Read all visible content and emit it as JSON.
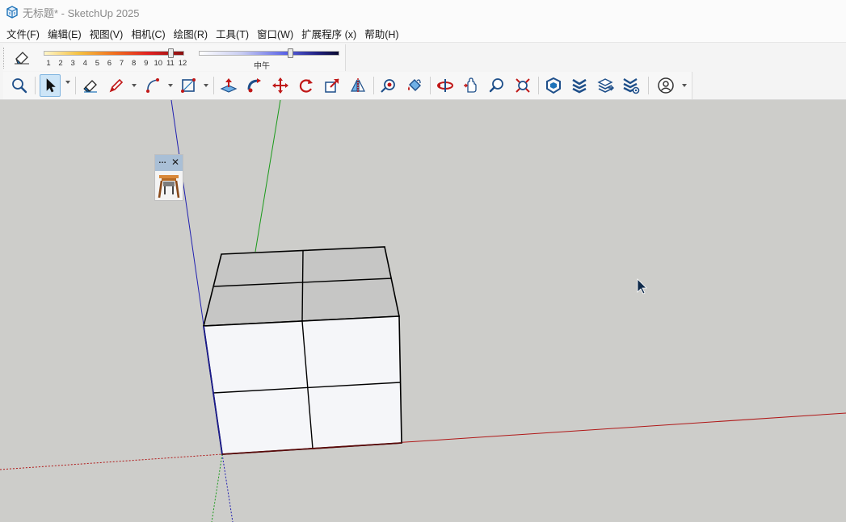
{
  "window": {
    "title": "无标题* - SketchUp 2025"
  },
  "menu": {
    "items": [
      {
        "label": "文件(F)"
      },
      {
        "label": "编辑(E)"
      },
      {
        "label": "视图(V)"
      },
      {
        "label": "相机(C)"
      },
      {
        "label": "绘图(R)"
      },
      {
        "label": "工具(T)"
      },
      {
        "label": "窗口(W)"
      },
      {
        "label": "扩展程序 (x)"
      },
      {
        "label": "帮助(H)"
      }
    ]
  },
  "shadow_toolbar": {
    "hour_ticks": [
      "1",
      "2",
      "3",
      "4",
      "5",
      "6",
      "7",
      "8",
      "9",
      "10",
      "11",
      "12"
    ],
    "hour_value": 0.9,
    "time_label": "中午",
    "time_value": 0.65,
    "hour_gradient_colors": [
      "#fff6c8",
      "#f5c040",
      "#f07020",
      "#e02020",
      "#8a1010"
    ],
    "time_gradient_colors": [
      "#ffffff",
      "#5a63e6",
      "#0a0a30"
    ]
  },
  "tools": [
    {
      "name": "zoom-extents-icon"
    },
    {
      "name": "select-icon"
    },
    {
      "name": "eraser-icon"
    },
    {
      "name": "pencil-icon"
    },
    {
      "name": "arc-icon"
    },
    {
      "name": "rectangle-icon"
    },
    {
      "name": "push-pull-icon"
    },
    {
      "name": "follow-me-icon"
    },
    {
      "name": "move-icon"
    },
    {
      "name": "rotate-icon"
    },
    {
      "name": "scale-icon"
    },
    {
      "name": "mirror-icon"
    },
    {
      "name": "tape-measure-icon"
    },
    {
      "name": "paint-bucket-icon"
    },
    {
      "name": "orbit-icon"
    },
    {
      "name": "pan-icon"
    },
    {
      "name": "zoom-icon"
    },
    {
      "name": "zoom-window-icon"
    },
    {
      "name": "3d-warehouse-icon"
    },
    {
      "name": "extension-warehouse-icon"
    },
    {
      "name": "layout-icon"
    },
    {
      "name": "extension-manager-icon"
    },
    {
      "name": "account-icon"
    }
  ],
  "colors": {
    "viewport_bg": "#cdcdca",
    "accent_blue": "#1e73b9",
    "axis_red": "#b01818",
    "axis_green": "#1a9a1a",
    "axis_blue": "#2020b0"
  }
}
